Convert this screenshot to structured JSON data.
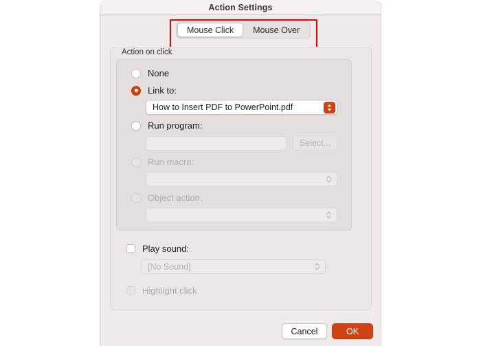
{
  "window": {
    "title": "Action Settings"
  },
  "tabs": [
    {
      "label": "Mouse Click",
      "selected": true
    },
    {
      "label": "Mouse Over",
      "selected": false
    }
  ],
  "annotation": {
    "color": "#e60000",
    "target": "tabs-segmented-control"
  },
  "action_group": {
    "label": "Action on click",
    "options": [
      {
        "label": "None",
        "selected": false,
        "enabled": true
      },
      {
        "label": "Link to:",
        "selected": true,
        "enabled": true
      },
      {
        "label": "Run program:",
        "selected": false,
        "enabled": true
      },
      {
        "label": "Run macro:",
        "selected": false,
        "enabled": false
      },
      {
        "label": "Object action:",
        "selected": false,
        "enabled": false
      }
    ],
    "link_to": {
      "value": "How to Insert PDF to PowerPoint.pdf",
      "enabled": true
    },
    "run_program": {
      "value": "",
      "placeholder": "",
      "select_button_label": "Select...",
      "enabled": false
    },
    "run_macro": {
      "value": "",
      "enabled": false
    },
    "object_action": {
      "value": "",
      "enabled": false
    }
  },
  "play_sound": {
    "label": "Play sound:",
    "checked": false,
    "enabled": true,
    "sound_value": "[No Sound]",
    "sound_enabled": false
  },
  "highlight_click": {
    "label": "Highlight click",
    "checked": false,
    "enabled": false
  },
  "footer": {
    "cancel_label": "Cancel",
    "ok_label": "OK"
  },
  "colors": {
    "accent": "#cc4314",
    "annotation": "#e60000",
    "dialog_bg": "#f0ebea",
    "panel_bg": "#ece6e5",
    "group_bg": "#e4dedd"
  }
}
